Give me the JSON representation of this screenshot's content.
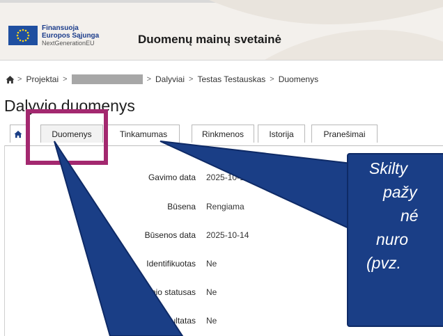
{
  "header": {
    "eu_line1": "Finansuoja",
    "eu_line2": "Europos Sąjunga",
    "eu_line3": "NextGenerationEU",
    "site_title": "Duomenų mainų svetainė"
  },
  "breadcrumb": {
    "items": [
      "Projektai",
      "Dalyviai",
      "Testas Testauskas",
      "Duomenys"
    ],
    "separator": ">"
  },
  "page_title": "Dalyvio duomenys",
  "tabs": [
    {
      "label": "Duomenys",
      "active": true
    },
    {
      "label": "Tinkamumas"
    },
    {
      "label": "Rinkmenos"
    },
    {
      "label": "Istorija"
    },
    {
      "label": "Pranešimai"
    }
  ],
  "details": [
    {
      "label": "Gavimo data",
      "value": "2025-10-14"
    },
    {
      "label": "Būsena",
      "value": "Rengiama"
    },
    {
      "label": "Būsenos data",
      "value": "2025-10-14"
    },
    {
      "label": "Identifikuotas",
      "value": "Ne"
    },
    {
      "label": "Nuolatinio statusas",
      "value": "Ne"
    },
    {
      "label": "Rezultatas",
      "value": "Ne"
    }
  ],
  "callout": {
    "lines": [
      "Skilty",
      "pažy",
      "né",
      "nuro",
      "(pvz."
    ]
  },
  "colors": {
    "highlight": "#a3286f",
    "callout_bg": "#1a3e86",
    "eu_blue": "#1f4fa0",
    "eu_star": "#ffd618"
  },
  "icons": {
    "breadcrumb_home": "home-icon",
    "tab_home": "home-icon",
    "eu_flag": "eu-flag-icon"
  }
}
